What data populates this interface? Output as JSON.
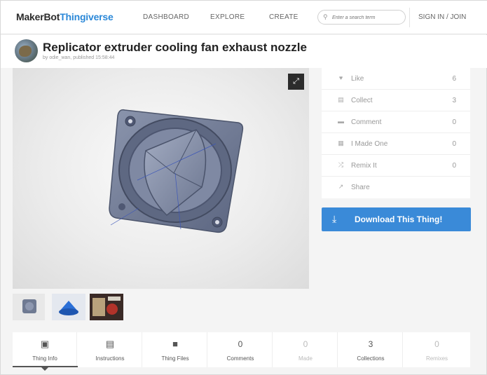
{
  "nav": {
    "logo_part1": "MakerBot",
    "logo_part2": "Thingiverse",
    "links": [
      "DASHBOARD",
      "EXPLORE",
      "CREATE"
    ],
    "search_placeholder": "Enter a search term",
    "signin": "SIGN IN / JOIN"
  },
  "thing": {
    "title": "Replicator extruder cooling fan exhaust nozzle",
    "byline": "by odie_wan, published 15:58:44"
  },
  "actions": [
    {
      "icon": "heart-icon",
      "label": "Like",
      "count": "6"
    },
    {
      "icon": "collect-icon",
      "label": "Collect",
      "count": "3"
    },
    {
      "icon": "comment-icon",
      "label": "Comment",
      "count": "0"
    },
    {
      "icon": "made-one-icon",
      "label": "I Made One",
      "count": "0"
    },
    {
      "icon": "remix-icon",
      "label": "Remix It",
      "count": "0"
    },
    {
      "icon": "share-icon",
      "label": "Share",
      "count": ""
    }
  ],
  "download_label": "Download This Thing!",
  "tabs": [
    {
      "icon": "thing-info-icon",
      "label": "Thing Info"
    },
    {
      "icon": "instructions-icon",
      "label": "Instructions"
    },
    {
      "icon": "thing-files-icon",
      "label": "Thing Files"
    },
    {
      "count": "0",
      "label": "Comments"
    },
    {
      "count": "0",
      "label": "Made"
    },
    {
      "count": "3",
      "label": "Collections"
    },
    {
      "count": "0",
      "label": "Remixes"
    }
  ],
  "colors": {
    "accent": "#3a8ad8",
    "logo_blue": "#2b88d8",
    "model": "#6f7a92"
  }
}
